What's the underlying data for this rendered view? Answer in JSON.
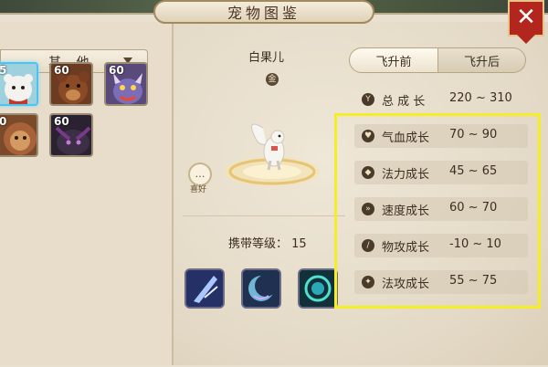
{
  "window": {
    "title": "宠物图鉴",
    "close_label": "✕"
  },
  "filter": {
    "selected": "其 他"
  },
  "pet_list": [
    {
      "level": "5",
      "selected": true
    },
    {
      "level": "60",
      "selected": false
    },
    {
      "level": "60",
      "selected": false
    },
    {
      "level": "0",
      "selected": false
    },
    {
      "level": "60",
      "selected": false
    }
  ],
  "pet": {
    "name": "白果儿",
    "badge": "金",
    "chat_icon_label": "…",
    "chat_label": "喜好",
    "carry_level_label": "携带等级：",
    "carry_level_value": "15"
  },
  "tabs": [
    {
      "label": "飞升前",
      "active": true
    },
    {
      "label": "飞升后",
      "active": false
    }
  ],
  "stats": [
    {
      "icon": "Y",
      "label": "总 成 长",
      "value": "220 ~ 310"
    },
    {
      "icon": "♥",
      "label": "气血成长",
      "value": "70 ~ 90"
    },
    {
      "icon": "◆",
      "label": "法力成长",
      "value": "45 ~ 65"
    },
    {
      "icon": "»",
      "label": "速度成长",
      "value": "60 ~ 70"
    },
    {
      "icon": "/",
      "label": "物攻成长",
      "value": "-10 ~ 10"
    },
    {
      "icon": "✦",
      "label": "法攻成长",
      "value": "55 ~ 75"
    }
  ],
  "colors": {
    "highlight": "#f5ee24",
    "close": "#b3261e",
    "selected_slot": "#4ec3f0"
  }
}
